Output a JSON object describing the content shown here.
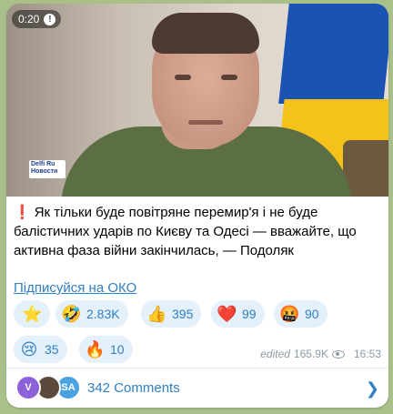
{
  "video": {
    "timer": "0:20",
    "logo_line1": "Delfi Ru",
    "logo_line2": "Новости"
  },
  "post": {
    "emoji": "❗",
    "text": "Як тільки буде повітряне перемир'я і не буде балістичних ударів по Києву та Одесі — вважайте, що активна фаза війни закінчилась, — Подоляк",
    "subscribe_link": "Підписуйся на ОКО"
  },
  "reactions": [
    {
      "emoji": "⭐",
      "count": ""
    },
    {
      "emoji": "🤣",
      "count": "2.83K"
    },
    {
      "emoji": "👍",
      "count": "395"
    },
    {
      "emoji": "❤️",
      "count": "99"
    },
    {
      "emoji": "🤬",
      "count": "90"
    },
    {
      "emoji": "😢",
      "count": "35"
    },
    {
      "emoji": "🔥",
      "count": "10"
    }
  ],
  "meta": {
    "edited": "edited",
    "views": "165.9K",
    "time": "16:53"
  },
  "comments": {
    "avatar1": "V",
    "avatar3": "SA",
    "label": "342 Comments"
  },
  "colors": {
    "accent": "#2f7fc4",
    "background": "#a9c08a",
    "pill": "#e4f0fa"
  }
}
